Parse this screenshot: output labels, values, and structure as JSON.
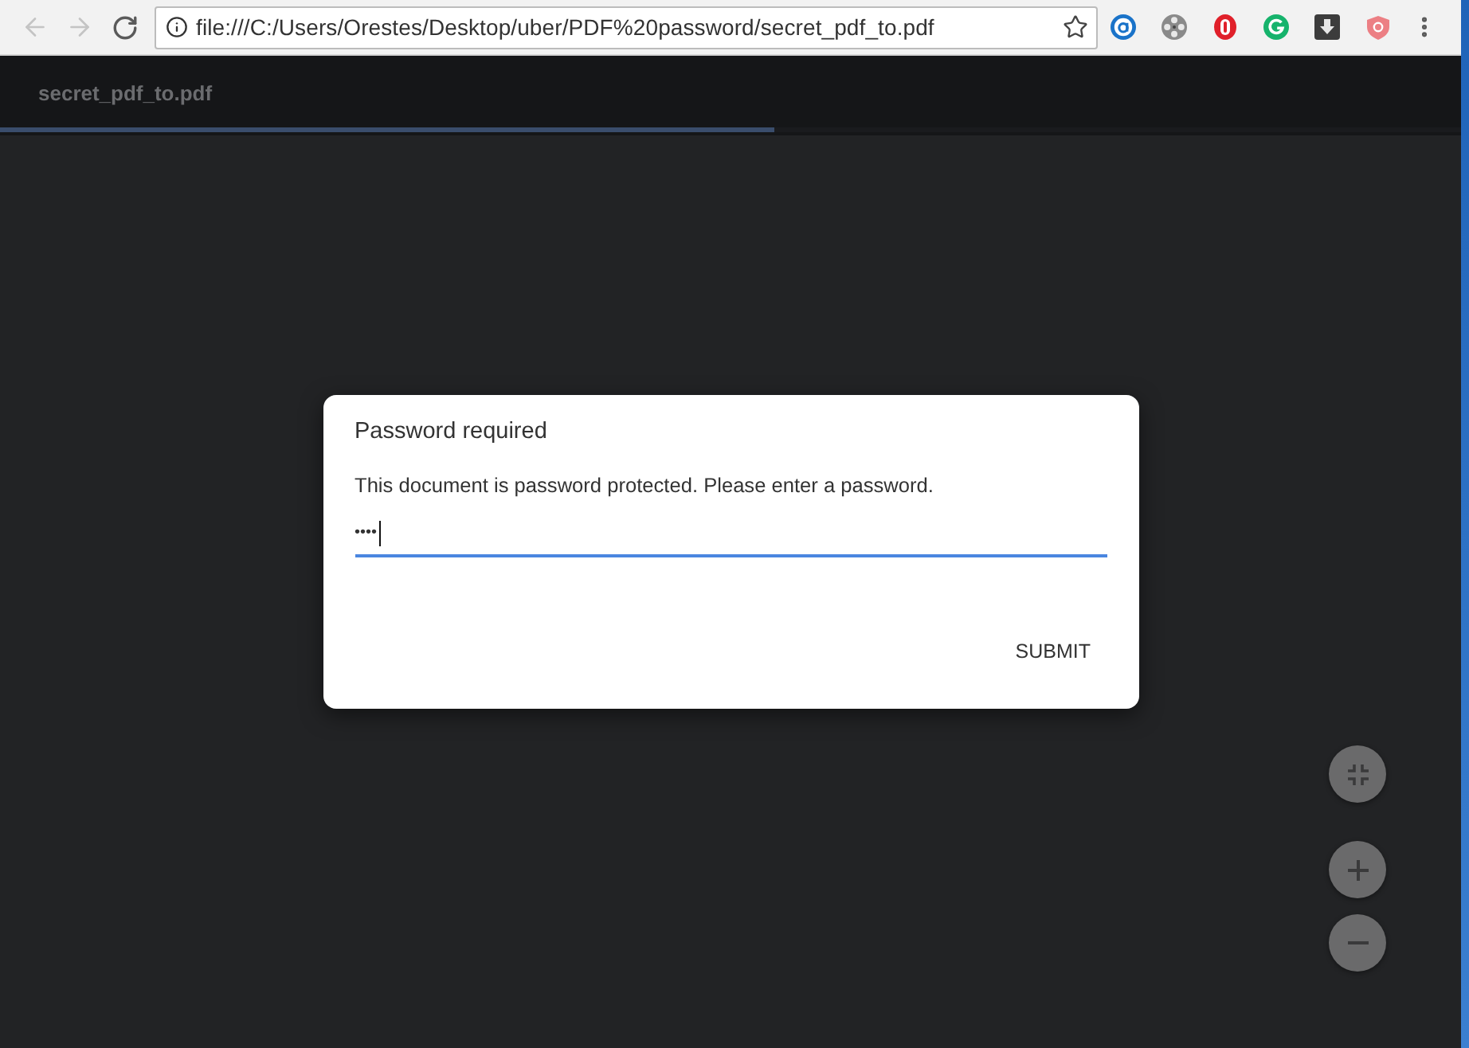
{
  "browser": {
    "back": {
      "disabled": true
    },
    "forward": {
      "disabled": true
    },
    "url": "file:///C:/Users/Orestes/Desktop/uber/PDF%20password/secret_pdf_to.pdf"
  },
  "viewer": {
    "title": "secret_pdf_to.pdf",
    "progress": {
      "level": 0.53
    }
  },
  "dialog": {
    "title": "Password required",
    "message": "This document is password protected. Please enter a password.",
    "password_field": {
      "value": "••••",
      "focused": true
    },
    "buttons": [
      "SUBMIT"
    ]
  }
}
